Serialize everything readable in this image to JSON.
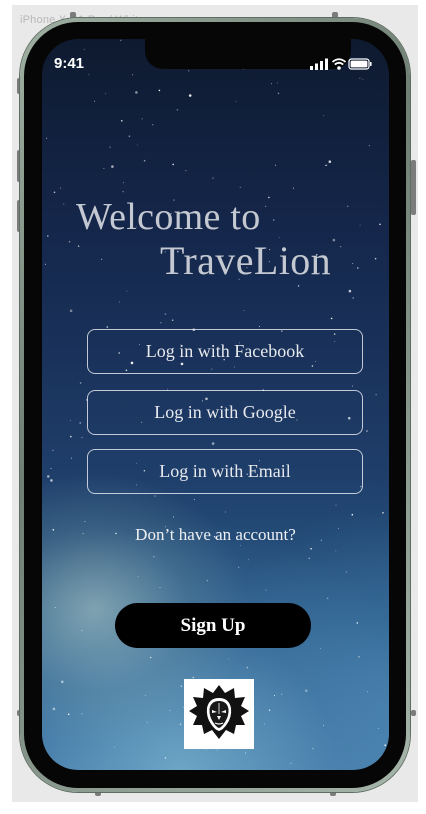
{
  "frame": {
    "label": "iPhone X, 11 Pro / White"
  },
  "status_bar": {
    "time": "9:41",
    "icons": [
      "signal-icon",
      "wifi-icon",
      "battery-icon"
    ]
  },
  "welcome": {
    "line1": "Welcome to",
    "line2": "TraveLion"
  },
  "login_buttons": [
    {
      "label": "Log in with Facebook"
    },
    {
      "label": "Log in with Google"
    },
    {
      "label": "Log in with Email"
    }
  ],
  "prompt": "Don’t have an account?",
  "signup_label": "Sign Up",
  "logo": {
    "icon": "lion-head-icon"
  },
  "colors": {
    "sky_top": "#0e1a2f",
    "sky_bottom": "#4a86b1",
    "text_light": "#c4c8d0",
    "signup_bg": "#000000"
  }
}
